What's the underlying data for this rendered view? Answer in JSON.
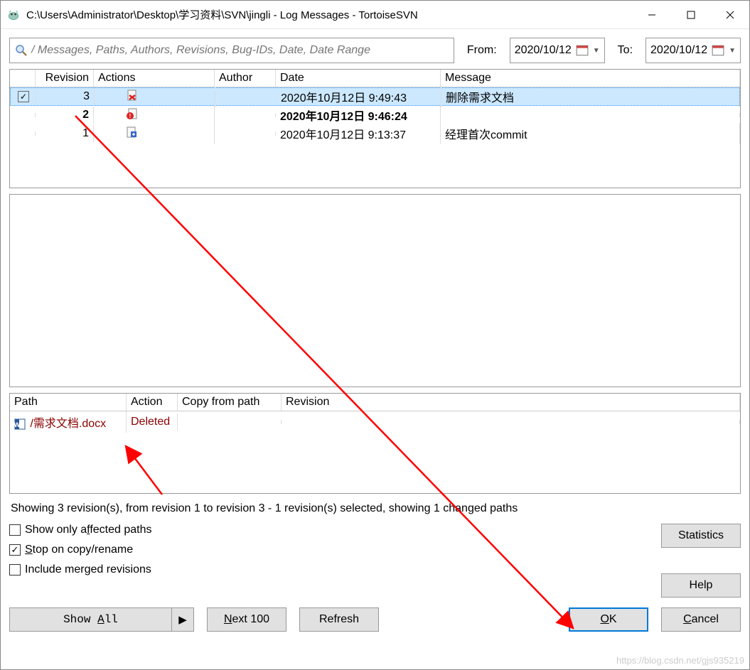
{
  "window_title": "C:\\Users\\Administrator\\Desktop\\学习资料\\SVN\\jingli - Log Messages - TortoiseSVN",
  "search": {
    "placeholder": "/ Messages, Paths, Authors, Revisions, Bug-IDs, Date, Date Range"
  },
  "date_filter": {
    "from_label": "From:",
    "from_value": "2020/10/12",
    "to_label": "To:",
    "to_value": "2020/10/12"
  },
  "columns": {
    "revision": "Revision",
    "actions": "Actions",
    "author": "Author",
    "date": "Date",
    "message": "Message"
  },
  "revisions": [
    {
      "checked": true,
      "rev": "3",
      "icon": "delete",
      "author": "",
      "date": "2020年10月12日 9:49:43",
      "msg": "删除需求文档",
      "selected": true,
      "bold": false
    },
    {
      "checked": false,
      "rev": "2",
      "icon": "modify",
      "author": "",
      "date": "2020年10月12日 9:46:24",
      "msg": "",
      "selected": false,
      "bold": true
    },
    {
      "checked": false,
      "rev": "1",
      "icon": "add",
      "author": "",
      "date": "2020年10月12日 9:13:37",
      "msg": "经理首次commit",
      "selected": false,
      "bold": false
    }
  ],
  "files_columns": {
    "path": "Path",
    "action": "Action",
    "copy": "Copy from path",
    "revision": "Revision"
  },
  "files": [
    {
      "path": "/需求文档.docx",
      "action": "Deleted",
      "copy": "",
      "revision": ""
    }
  ],
  "status_line": "Showing 3 revision(s), from revision 1 to revision 3 - 1 revision(s) selected, showing 1 changed paths",
  "options": {
    "show_only_affected": "Show only affected paths",
    "stop_on_copy": "Stop on copy/rename",
    "stop_on_copy_checked": true,
    "include_merged": "Include merged revisions"
  },
  "buttons": {
    "statistics": "Statistics",
    "help": "Help",
    "show_all": "Show All",
    "next_100": "Next 100",
    "refresh": "Refresh",
    "ok": "OK",
    "cancel": "Cancel"
  },
  "watermark": "https://blog.csdn.net/gjs935219"
}
